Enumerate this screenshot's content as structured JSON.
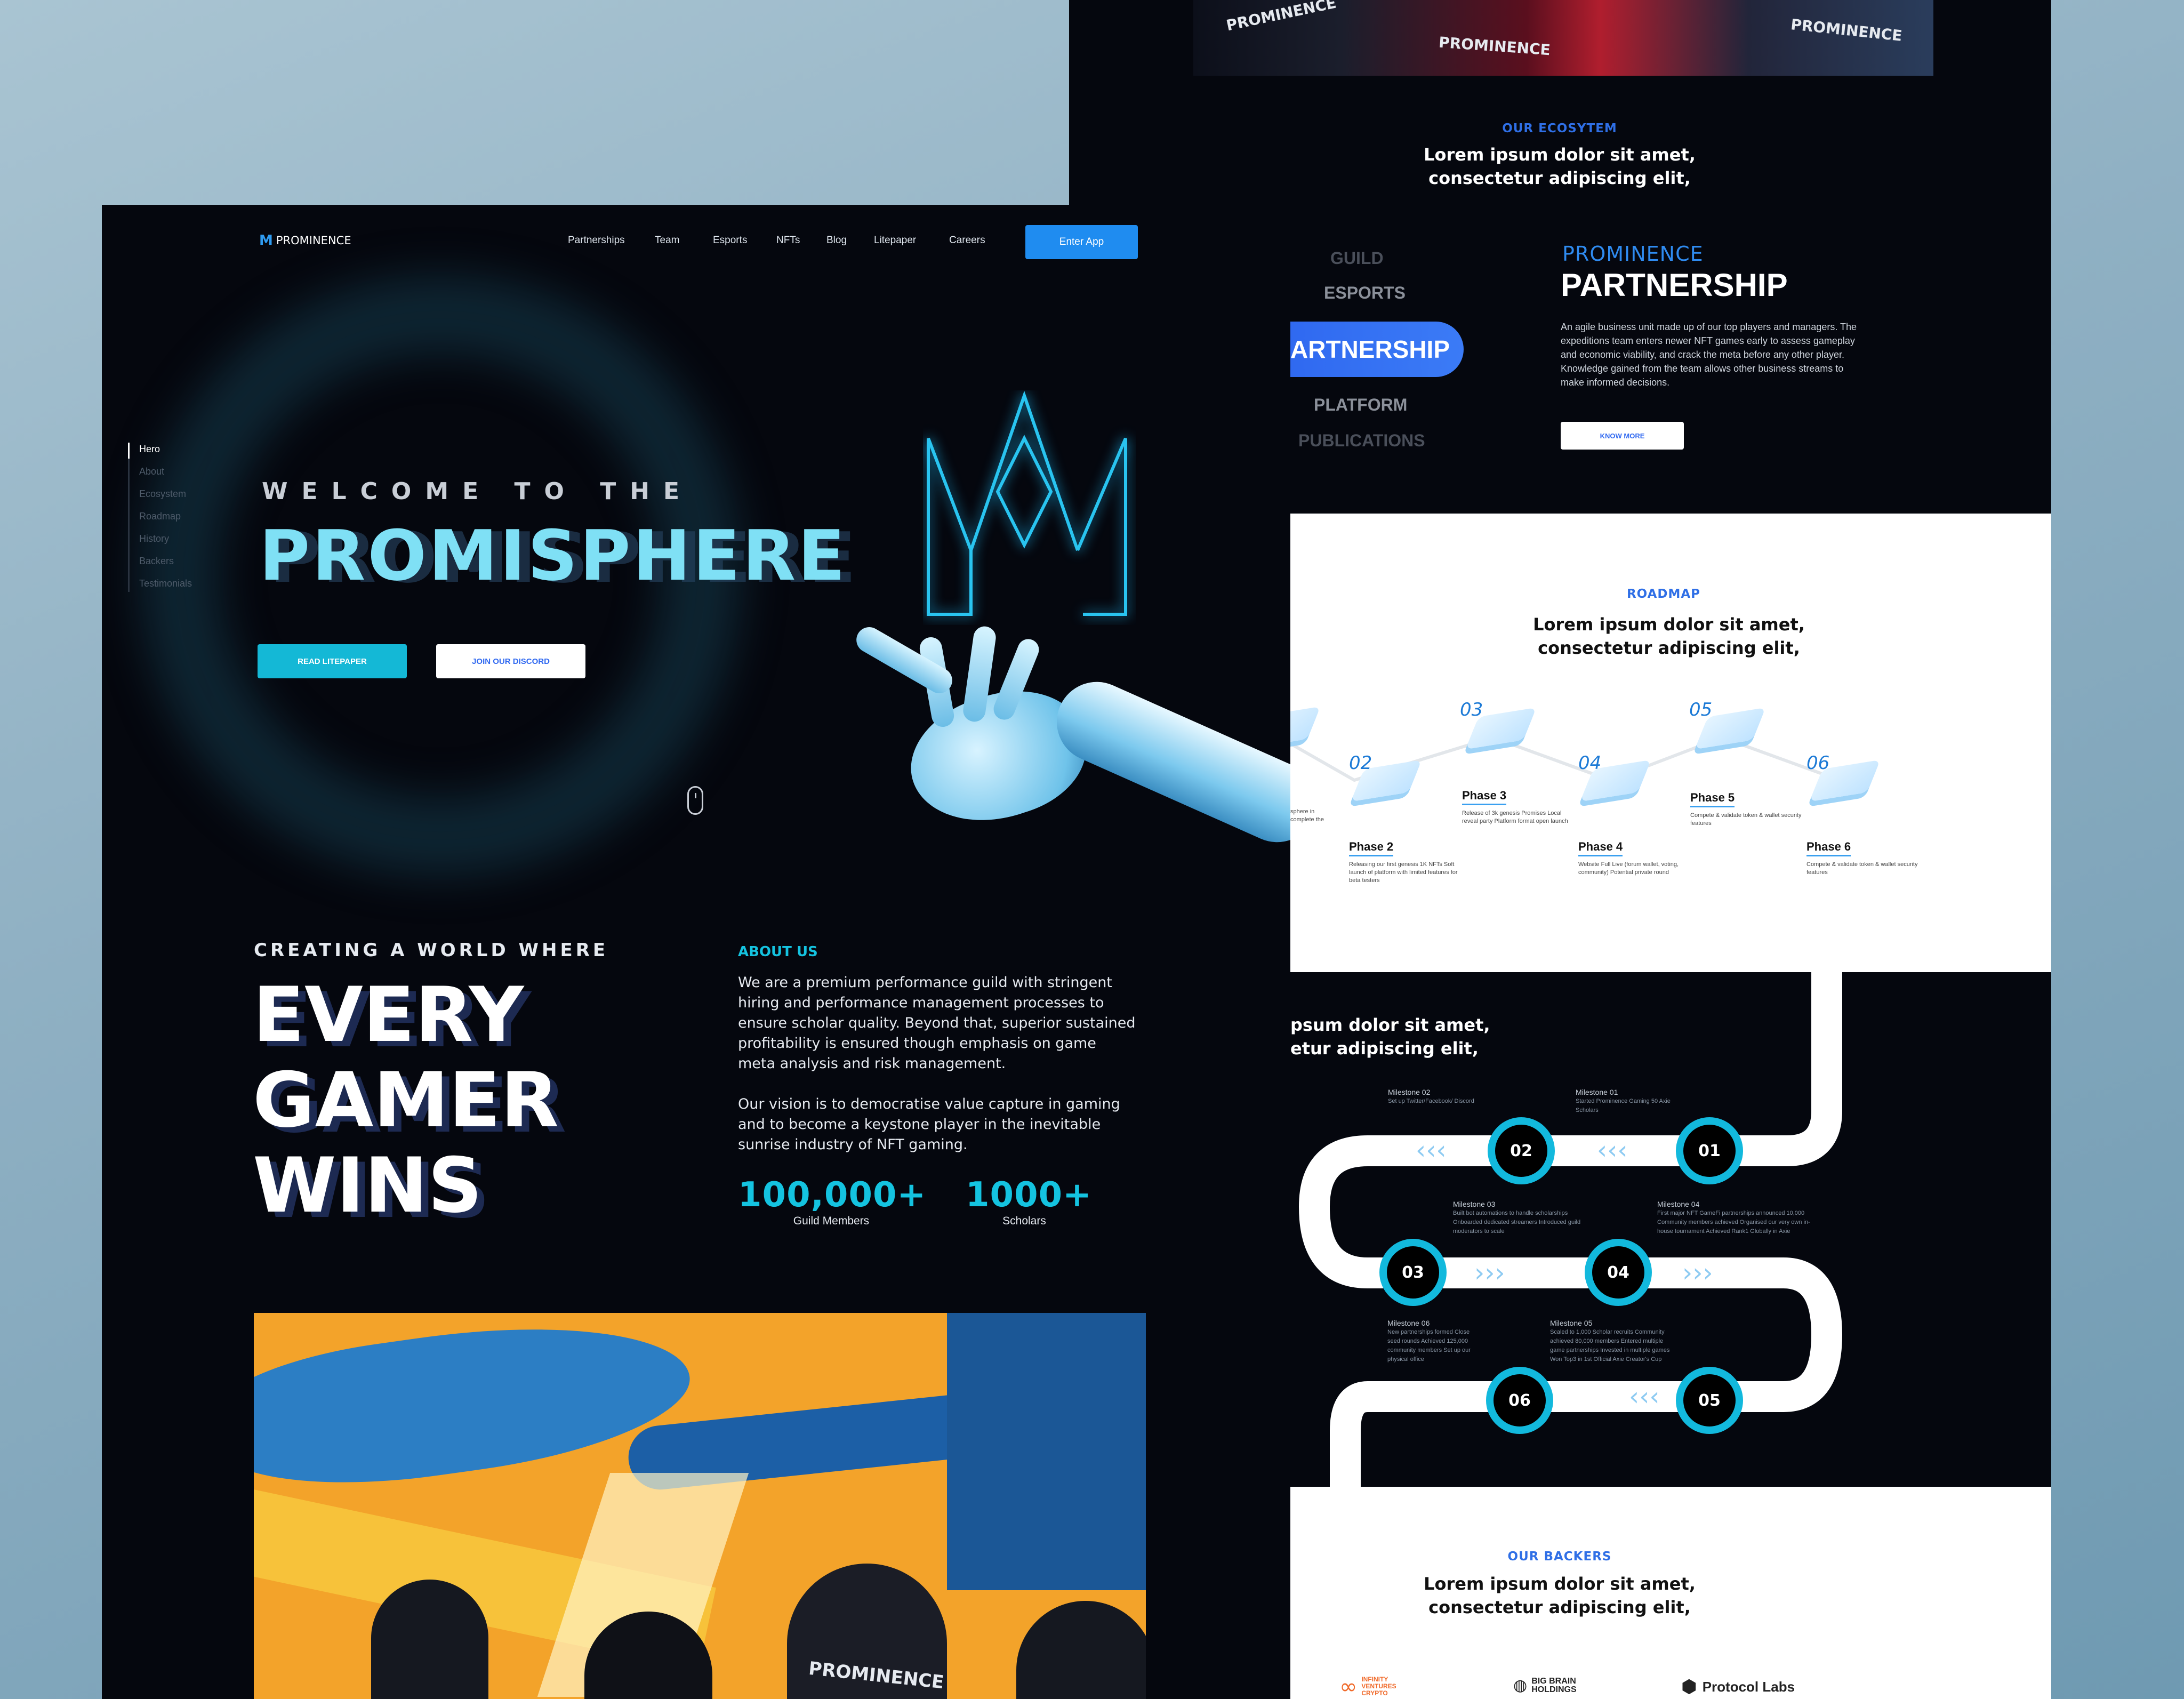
{
  "brand": {
    "name": "PROMINENCE",
    "accent": "#1f8cf0",
    "cyan": "#14c3e0",
    "dark": "#05070e"
  },
  "nav": {
    "links": [
      "Partnerships",
      "Team",
      "Esports",
      "NFTs",
      "Blog",
      "Litepaper",
      "Careers"
    ],
    "cta": "Enter App"
  },
  "side_nav": [
    "Hero",
    "About",
    "Ecosystem",
    "Roadmap",
    "History",
    "Backers",
    "Testimonials"
  ],
  "hero": {
    "welcome": "WELCOME TO THE",
    "title": "PROMISPHERE",
    "btn_primary": "READ LITEPAPER",
    "btn_secondary": "JOIN OUR DISCORD"
  },
  "about": {
    "creating": "CREATING A WORLD WHERE",
    "headline": [
      "EVERY",
      "GAMER",
      "WINS"
    ],
    "label": "ABOUT US",
    "para1": "We are a premium performance guild with stringent hiring and performance management processes to ensure scholar quality. Beyond that, superior sustained profitability is ensured though emphasis on game meta analysis and risk management.",
    "para2": "Our vision is to democratise value capture in gaming and to become a keystone player in the inevitable sunrise industry of NFT gaming.",
    "stats": [
      {
        "value": "100,000+",
        "label": "Guild Members"
      },
      {
        "value": "1000+",
        "label": "Scholars"
      }
    ]
  },
  "ecosystem": {
    "label": "OUR ECOSYTEM",
    "heading": "Lorem ipsum dolor sit amet, consectetur adipiscing elit,",
    "tabs": [
      "GUILD",
      "ESPORTS",
      "ARTNERSHIP",
      "PLATFORM",
      "PUBLICATIONS"
    ],
    "brand_small": "PROMINENCE",
    "title": "PARTNERSHIP",
    "body": "An agile business unit made up of our top players and managers. The expeditions team enters newer NFT games early to assess gameplay and economic viability, and crack the meta before any other player. Knowledge gained from the team allows other business streams to make informed decisions.",
    "button": "KNOW MORE"
  },
  "roadmap": {
    "label": "ROADMAP",
    "heading": "Lorem ipsum dolor sit amet, consectetur adipiscing elit,",
    "numbers": [
      "02",
      "03",
      "04",
      "05",
      "06"
    ],
    "phases": [
      {
        "title": "Phase 2",
        "desc": "Releasing our first genesis 1K NFTs Soft launch of platform with limited features for beta testers"
      },
      {
        "title": "Phase 3",
        "desc": "Release of 3k genesis Promises Local reveal party Platform format open launch"
      },
      {
        "title": "Phase 4",
        "desc": "Website Full Live (forum wallet, voting, community) Potential private round"
      },
      {
        "title": "Phase 5",
        "desc": "Compete & validate token & wallet security features"
      },
      {
        "title": "Phase 6",
        "desc": "Compete & validate token & wallet security features"
      }
    ],
    "clipped_text": "sphere in complete the"
  },
  "history": {
    "heading_lines": [
      "psum dolor sit amet,",
      "etur adipiscing elit,"
    ],
    "milestones": [
      {
        "num": "01",
        "title": "Milestone 01",
        "desc": "Started Prominence Gaming 50 Axie Scholars"
      },
      {
        "num": "02",
        "title": "Milestone 02",
        "desc": "Set up Twitter/Facebook/ Discord"
      },
      {
        "num": "03",
        "title": "Milestone 03",
        "desc": "Built bot automations to handle scholarships Onboarded dedicated streamers Introduced guild moderators to scale"
      },
      {
        "num": "04",
        "title": "Milestone 04",
        "desc": "First major NFT GameFi partnerships announced 10,000 Community members achieved Organised our very own in-house tournament Achieved Rank1 Globally in Axie"
      },
      {
        "num": "05",
        "title": "Milestone 05",
        "desc": "Scaled to 1,000 Scholar recruits Community achieved 80,000 members Entered multiple game partnerships Invested in multiple games Won Top3 in 1st Official Axie Creator's Cup"
      },
      {
        "num": "06",
        "title": "Milestone 06",
        "desc": "New partnerships formed Close seed rounds Achieved 125,000 community members Set up our physical office"
      }
    ]
  },
  "backers": {
    "label": "OUR BACKERS",
    "heading": "Lorem ipsum dolor sit amet, consectetur adipiscing elit,",
    "logos": [
      "INFINITY VENTURES CRYPTO",
      "BIG BRAIN HOLDINGS",
      "Protocol Labs"
    ]
  },
  "scroll_hint": "mouse-scroll-icon"
}
